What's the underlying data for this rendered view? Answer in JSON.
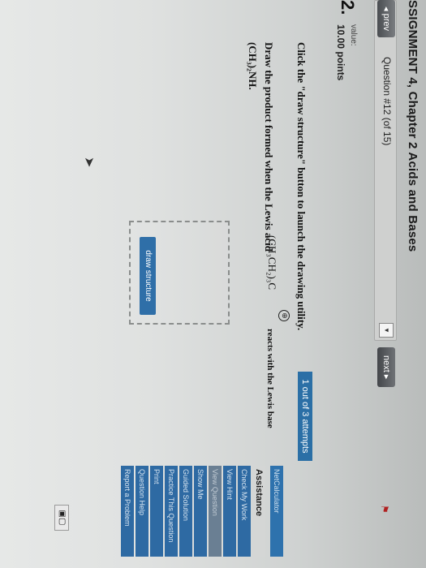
{
  "header": {
    "title": "SSIGNMENT 4, Chapter 2 Acids and Bases"
  },
  "nav": {
    "prev_label": "◂ prev",
    "question_label": "Question #12 (of 15)",
    "dropdown_glyph": "▼",
    "next_label": "next ▸"
  },
  "question": {
    "number": "2.",
    "value_label": "value:",
    "points": "10.00 points",
    "instructions": "Click the \"draw structure\" button to launch the drawing utility.",
    "text": "Draw the product formed when the Lewis acid",
    "cation_formula": "(CH₃CH₂)₃C",
    "charge": "⊕",
    "reacts_text": "reacts with the Lewis base",
    "compound_formula": "(CH₃)₂NH."
  },
  "attempts": "1 out of 3 attempts",
  "drawing": {
    "button_label": "draw structure"
  },
  "sidebar": {
    "net_calculator": "NetCalculator",
    "assistance_title": "Assistance",
    "items": [
      {
        "label": "Check My Work"
      },
      {
        "label": "View Hint"
      },
      {
        "label": "View Question"
      },
      {
        "label": "Show Me"
      },
      {
        "label": "Guided Solution"
      },
      {
        "label": "Practice This Question"
      },
      {
        "label": "Print"
      },
      {
        "label": "Question Help"
      },
      {
        "label": "Report a Problem"
      }
    ]
  },
  "colors": {
    "accent_blue": "#2e6aa3",
    "background": "#dfe1e0"
  }
}
